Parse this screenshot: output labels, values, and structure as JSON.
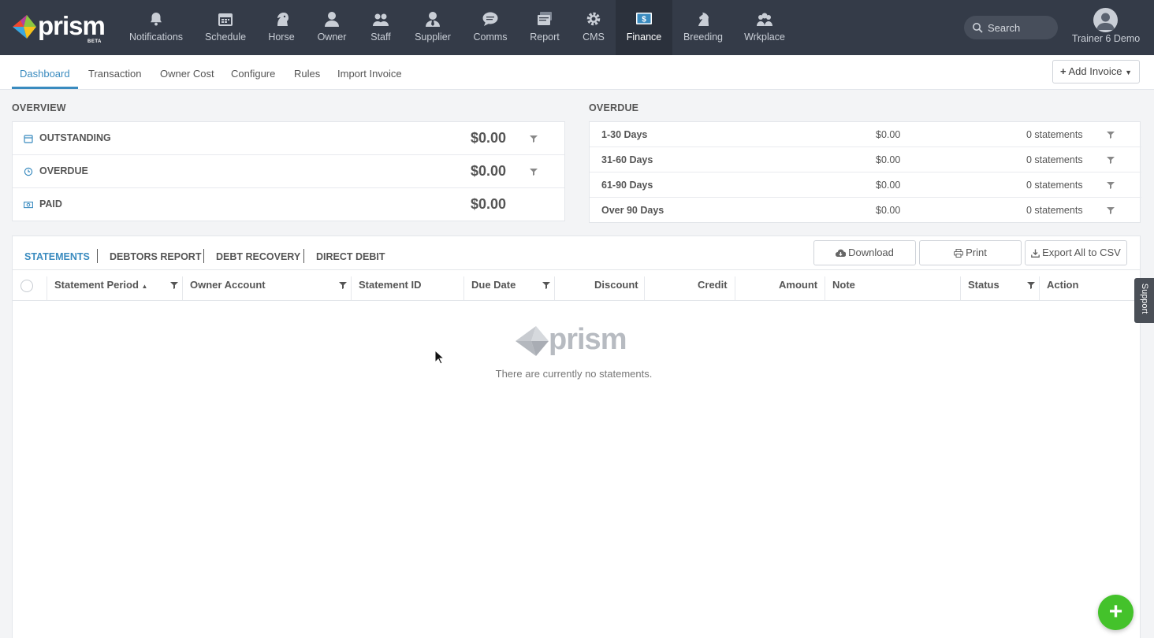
{
  "app": {
    "logo_text": "prism",
    "logo_badge": "BETA"
  },
  "nav": {
    "items": [
      {
        "label": "Notifications",
        "icon": "bell-icon"
      },
      {
        "label": "Schedule",
        "icon": "calendar-icon"
      },
      {
        "label": "Horse",
        "icon": "horse-head-icon"
      },
      {
        "label": "Owner",
        "icon": "person-icon"
      },
      {
        "label": "Staff",
        "icon": "group-icon"
      },
      {
        "label": "Supplier",
        "icon": "person-tie-icon"
      },
      {
        "label": "Comms",
        "icon": "chat-bubble-icon"
      },
      {
        "label": "Report",
        "icon": "report-stack-icon"
      },
      {
        "label": "CMS",
        "icon": "gear-icon"
      },
      {
        "label": "Finance",
        "icon": "dollar-icon",
        "active": true
      },
      {
        "label": "Breeding",
        "icon": "chess-knight-icon"
      },
      {
        "label": "Wrkplace",
        "icon": "people-icon"
      }
    ],
    "search_placeholder": "Search",
    "user_name": "Trainer 6 Demo"
  },
  "subnav": {
    "tabs": [
      "Dashboard",
      "Transaction",
      "Owner Cost",
      "Configure",
      "Rules",
      "Import Invoice"
    ],
    "active_tab": "Dashboard",
    "add_invoice_label": "Add Invoice"
  },
  "overview": {
    "title": "OVERVIEW",
    "rows": [
      {
        "label": "OUTSTANDING",
        "amount": "$0.00",
        "icon": "calendar-icon"
      },
      {
        "label": "OVERDUE",
        "amount": "$0.00",
        "icon": "clock-icon"
      },
      {
        "label": "PAID",
        "amount": "$0.00",
        "icon": "money-icon"
      }
    ]
  },
  "overdue": {
    "title": "OVERDUE",
    "rows": [
      {
        "label": "1-30 Days",
        "amount": "$0.00",
        "count": "0 statements"
      },
      {
        "label": "31-60 Days",
        "amount": "$0.00",
        "count": "0 statements"
      },
      {
        "label": "61-90 Days",
        "amount": "$0.00",
        "count": "0 statements"
      },
      {
        "label": "Over 90 Days",
        "amount": "$0.00",
        "count": "0 statements"
      }
    ]
  },
  "statements": {
    "tabs": [
      "STATEMENTS",
      "DEBTORS REPORT",
      "DEBT RECOVERY",
      "DIRECT DEBIT"
    ],
    "active_tab": "STATEMENTS",
    "buttons": {
      "download": "Download",
      "print": "Print",
      "export": "Export All to CSV"
    },
    "columns": [
      "Statement Period",
      "Owner Account",
      "Statement ID",
      "Due Date",
      "Discount",
      "Credit",
      "Amount",
      "Note",
      "Status",
      "Action"
    ],
    "empty_logo_text": "prism",
    "empty_message": "There are currently no statements."
  },
  "support_label": "Support",
  "fab_label": "+",
  "colors": {
    "nav_bg": "#343b48",
    "accent": "#3a8bbf",
    "fab": "#44c22b"
  }
}
